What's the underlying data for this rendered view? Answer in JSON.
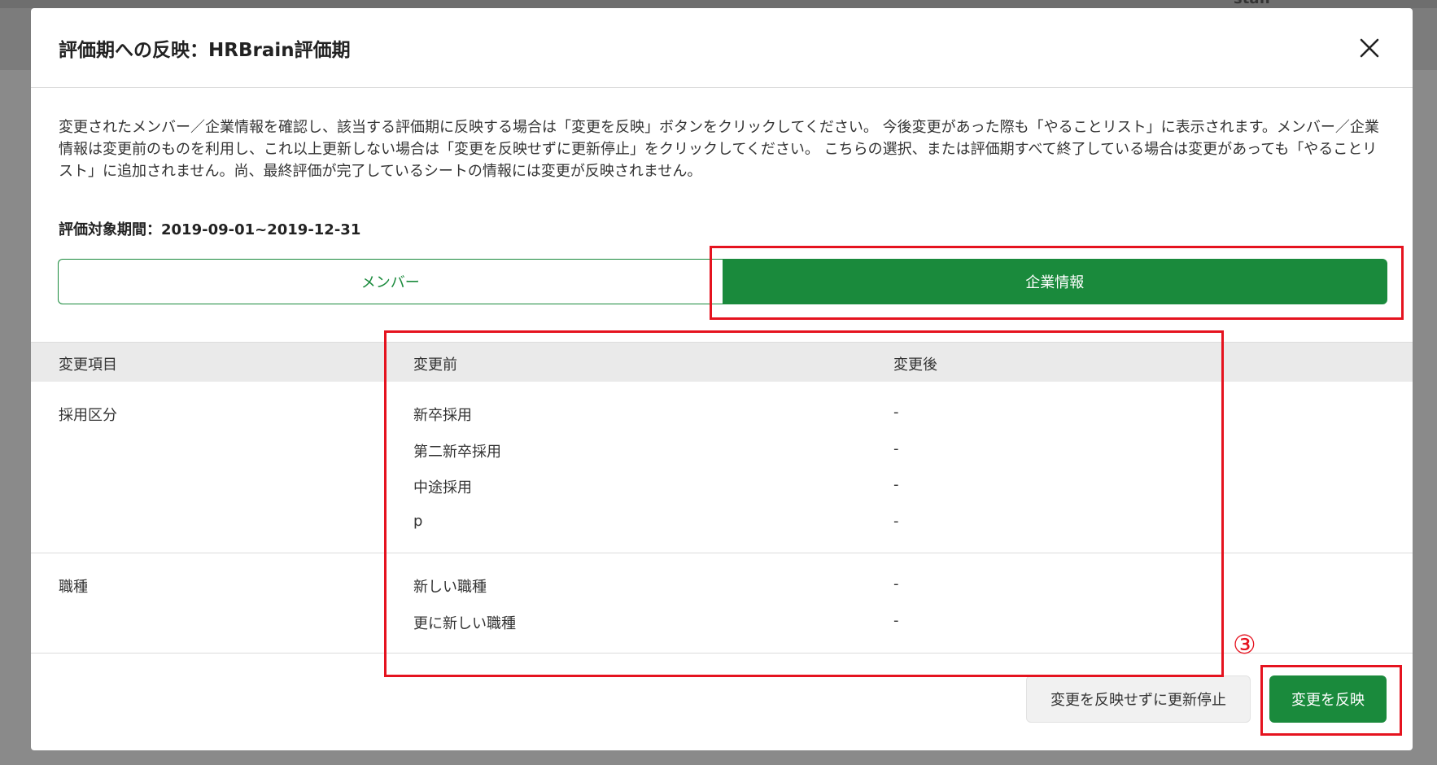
{
  "background": {
    "header_text": "staff"
  },
  "dialog": {
    "title": "評価期への反映：HRBrain評価期",
    "description": "変更されたメンバー／企業情報を確認し、該当する評価期に反映する場合は「変更を反映」ボタンをクリックしてください。 今後変更があった際も「やることリスト」に表示されます。メンバー／企業情報は変更前のものを利用し、これ以上更新しない場合は「変更を反映せずに更新停止」をクリックしてください。 こちらの選択、または評価期すべて終了している場合は変更があっても「やることリスト」に追加されません。尚、最終評価が完了しているシートの情報には変更が反映されません。",
    "period": "評価対象期間：2019-09-01~2019-12-31",
    "tabs": {
      "member": "メンバー",
      "company": "企業情報",
      "active": "企業情報"
    },
    "table": {
      "headers": {
        "item": "変更項目",
        "before": "変更前",
        "after": "変更後"
      },
      "rows": [
        {
          "item": "採用区分",
          "before": [
            "新卒採用",
            "第二新卒採用",
            "中途採用",
            "p"
          ],
          "after": [
            "-",
            "-",
            "-",
            "-"
          ]
        },
        {
          "item": "職種",
          "before": [
            "新しい職種",
            "更に新しい職種"
          ],
          "after": [
            "-",
            "-"
          ]
        }
      ]
    },
    "buttons": {
      "stop": "変更を反映せずに更新停止",
      "apply": "変更を反映"
    }
  },
  "annotation": {
    "step": "③",
    "color": "#e5131f"
  },
  "colors": {
    "primary": "#1a8a3c",
    "highlight": "#e5131f"
  }
}
